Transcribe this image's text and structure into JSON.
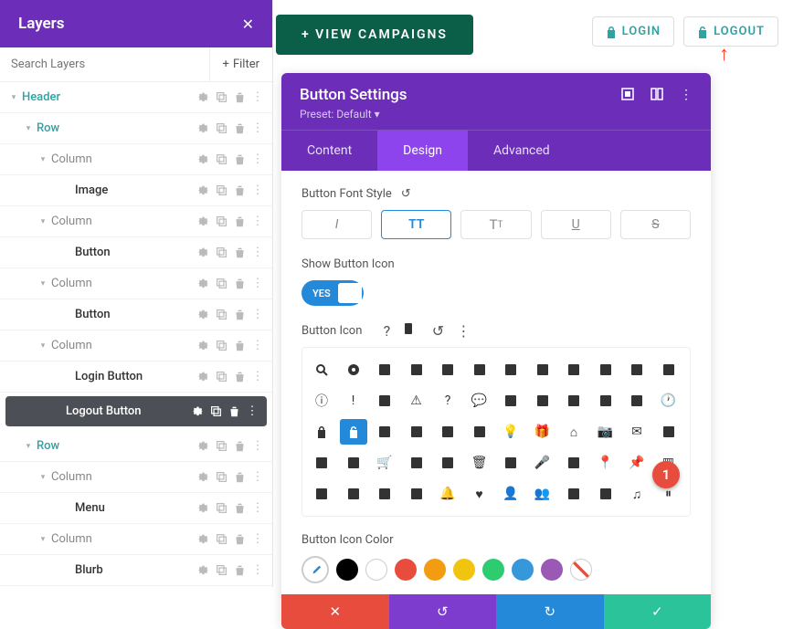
{
  "layers": {
    "title": "Layers",
    "search_placeholder": "Search Layers",
    "filter": "Filter",
    "tree": [
      {
        "pad": "pad-1",
        "caret": "▾",
        "label": "Header",
        "cls": "teal"
      },
      {
        "pad": "pad-2",
        "caret": "▾",
        "label": "Row",
        "cls": "teal"
      },
      {
        "pad": "pad-3",
        "caret": "▾",
        "label": "Column"
      },
      {
        "pad": "pad-4n",
        "label": "Image",
        "cls": "bold"
      },
      {
        "pad": "pad-3",
        "caret": "▾",
        "label": "Column"
      },
      {
        "pad": "pad-4n",
        "label": "Button",
        "cls": "bold"
      },
      {
        "pad": "pad-3",
        "caret": "▾",
        "label": "Column"
      },
      {
        "pad": "pad-4n",
        "label": "Button",
        "cls": "bold"
      },
      {
        "pad": "pad-3",
        "caret": "▾",
        "label": "Column"
      },
      {
        "pad": "pad-4n",
        "label": "Login Button",
        "cls": "bold"
      },
      {
        "pad": "pad-3n",
        "label": "Logout Button",
        "sel": true
      },
      {
        "pad": "pad-2",
        "caret": "▾",
        "label": "Row",
        "cls": "teal"
      },
      {
        "pad": "pad-3",
        "caret": "▾",
        "label": "Column"
      },
      {
        "pad": "pad-4n",
        "label": "Menu",
        "cls": "bold"
      },
      {
        "pad": "pad-3",
        "caret": "▾",
        "label": "Column"
      },
      {
        "pad": "pad-4n",
        "label": "Blurb",
        "cls": "bold"
      }
    ]
  },
  "top": {
    "login": "LOGIN",
    "logout": "LOGOUT",
    "campaign": "+ VIEW CAMPAIGNS"
  },
  "settings": {
    "title": "Button Settings",
    "preset": "Preset: Default ▾",
    "tabs": {
      "content": "Content",
      "design": "Design",
      "advanced": "Advanced"
    },
    "font_label": "Button Font Style",
    "show_icon_label": "Show Button Icon",
    "toggle_text": "YES",
    "icon_label": "Button Icon",
    "color_label": "Button Icon Color",
    "colors": [
      "#000000",
      "#ffffff",
      "#e74c3c",
      "#f39c12",
      "#f1c40f",
      "#2ecc71",
      "#3498db",
      "#9b59b6"
    ]
  },
  "badge": "1"
}
